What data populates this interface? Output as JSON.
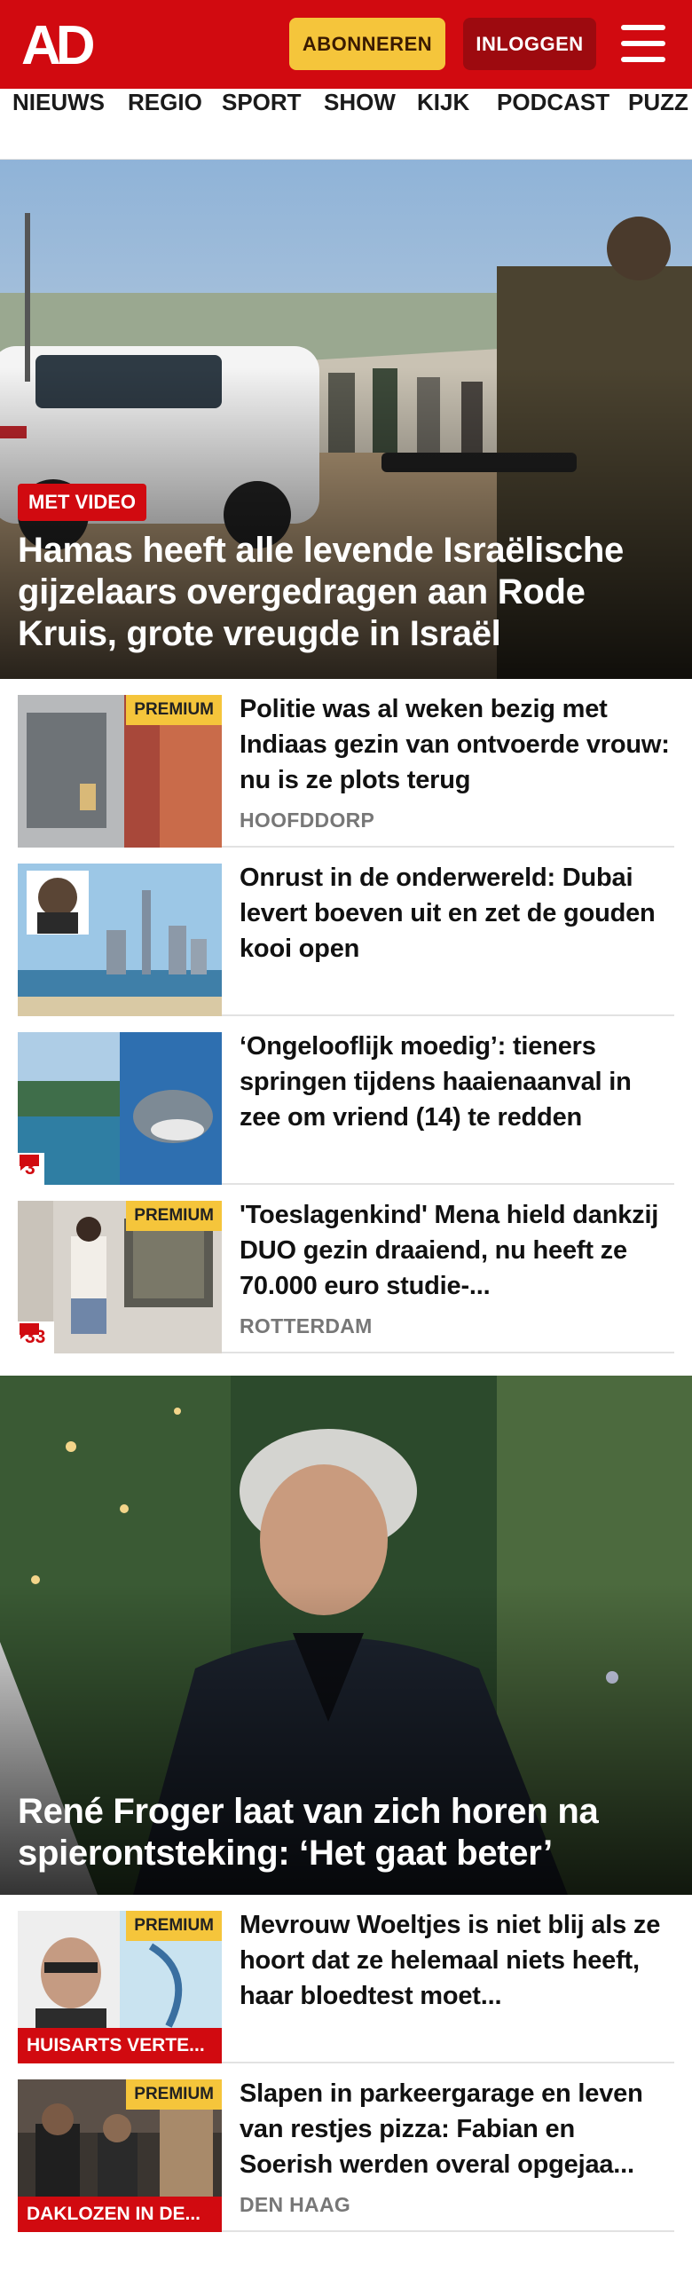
{
  "brand": {
    "logo_text": "AD",
    "red": "#d10a10",
    "dark_red": "#9d0a0f",
    "premium_yellow": "#f5c53b"
  },
  "header": {
    "subscribe_label": "ABONNEREN",
    "login_label": "INLOGGEN",
    "menu_icon": "hamburger-menu-icon"
  },
  "nav": {
    "items": [
      "NIEUWS",
      "REGIO",
      "SPORT",
      "SHOW",
      "KIJK",
      "PODCAST",
      "PUZZ"
    ]
  },
  "hero1": {
    "badge": "MET VIDEO",
    "title": "Hamas heeft alle levende Israëlische gijzelaars overgedragen aan Rode Kruis, grote vreugde in Israël"
  },
  "articles": [
    {
      "title": "Politie was al weken bezig met Indiaas gezin van ontvoerde vrouw: nu is ze plots terug",
      "location": "HOOFDDORP",
      "premium": "PREMIUM",
      "comments": ""
    },
    {
      "title": "Onrust in de onderwereld: Dubai levert boeven uit en zet de gouden kooi open",
      "location": "",
      "premium": "",
      "comments": ""
    },
    {
      "title": "‘Ongelooflijk moedig’: tieners springen tijdens haaienaanval in zee om vriend (14) te redden",
      "location": "",
      "premium": "",
      "comments": "3"
    },
    {
      "title": "'Toeslagenkind' Mena hield dankzij DUO gezin draaiend, nu heeft ze 70.000 euro studie-...",
      "location": "ROTTERDAM",
      "premium": "PREMIUM",
      "comments": "33"
    }
  ],
  "hero2": {
    "title": "René Froger laat van zich horen na spierontsteking: ‘Het gaat beter’"
  },
  "articles2": [
    {
      "title": "Mevrouw Woeltjes is niet blij als ze hoort dat ze helemaal niets heeft, haar bloedtest moet...",
      "location": "",
      "premium": "PREMIUM",
      "section": "HUISARTS VERTE..."
    },
    {
      "title": "Slapen in parkeergarage en leven van restjes pizza: Fabian en Soerish werden overal opgejaa...",
      "location": "DEN HAAG",
      "premium": "PREMIUM",
      "section": "DAKLOZEN IN DE..."
    }
  ]
}
